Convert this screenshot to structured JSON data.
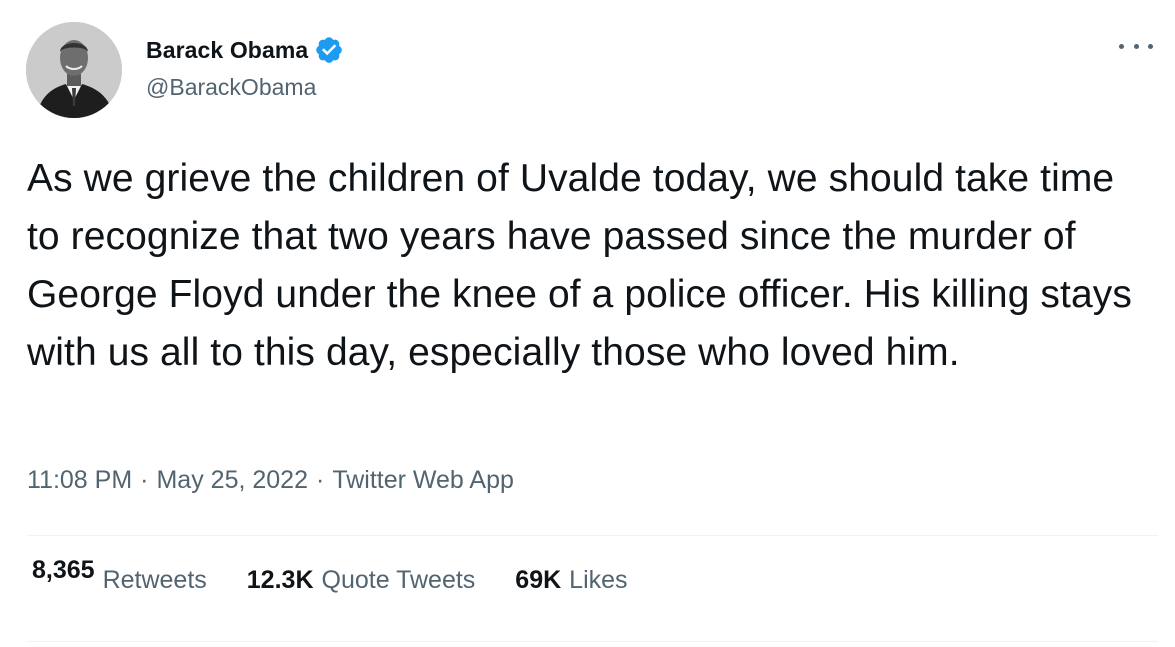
{
  "author": {
    "display_name": "Barack Obama",
    "handle": "@BarackObama",
    "verified": true,
    "avatar_icon": "profile-photo"
  },
  "tweet": {
    "text": "As we grieve the children of Uvalde today, we should take time to recognize that two years have passed since the murder of George Floyd under the knee of a police officer. His killing stays with us all to this day, especially those who loved him.",
    "time": "11:08 PM",
    "date": "May 25, 2022",
    "source": "Twitter Web App",
    "separator": "·"
  },
  "stats": {
    "retweets_count": "8,365",
    "retweets_label": "Retweets",
    "quote_count": "12.3K",
    "quote_label": "Quote Tweets",
    "likes_count": "69K",
    "likes_label": "Likes"
  },
  "colors": {
    "verified_blue": "#1d9bf0",
    "text_primary": "#0f1419",
    "text_secondary": "#536471",
    "divider": "#eff3f4"
  }
}
